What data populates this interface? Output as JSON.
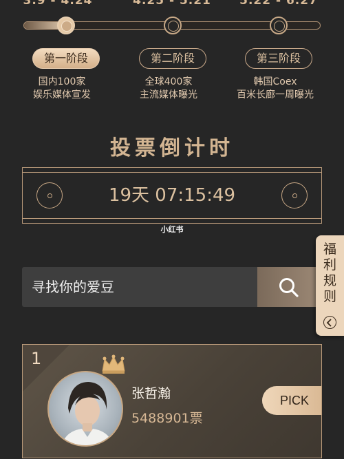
{
  "timeline": {
    "progress_percent": 15,
    "stages": [
      {
        "date": "3.9 - 4.24",
        "label": "第一阶段",
        "desc_line1": "国内100家",
        "desc_line2": "娱乐媒体宣发",
        "active": true
      },
      {
        "date": "4.25 - 5.21",
        "label": "第二阶段",
        "desc_line1": "全球400家",
        "desc_line2": "主流媒体曝光",
        "active": false
      },
      {
        "date": "5.22 - 6.27",
        "label": "第三阶段",
        "desc_line1": "韩国Coex",
        "desc_line2": "百米长廊一周曝光",
        "active": false
      }
    ]
  },
  "countdown": {
    "title": "投票倒计时",
    "value": "19天 07:15:49"
  },
  "watermark": "小红书",
  "search": {
    "placeholder": "寻找你的爱豆",
    "icon": "search-icon"
  },
  "side_tab": {
    "label": "福利规则",
    "icon": "chevron-left-icon"
  },
  "ranking": {
    "items": [
      {
        "rank": "1",
        "name": "张哲瀚",
        "votes": "5488901票",
        "pick_label": "PICK",
        "badge_icon": "crown-icon"
      }
    ]
  },
  "colors": {
    "background": "#262626",
    "gold": "#d3b592",
    "card": "#4a4238"
  }
}
